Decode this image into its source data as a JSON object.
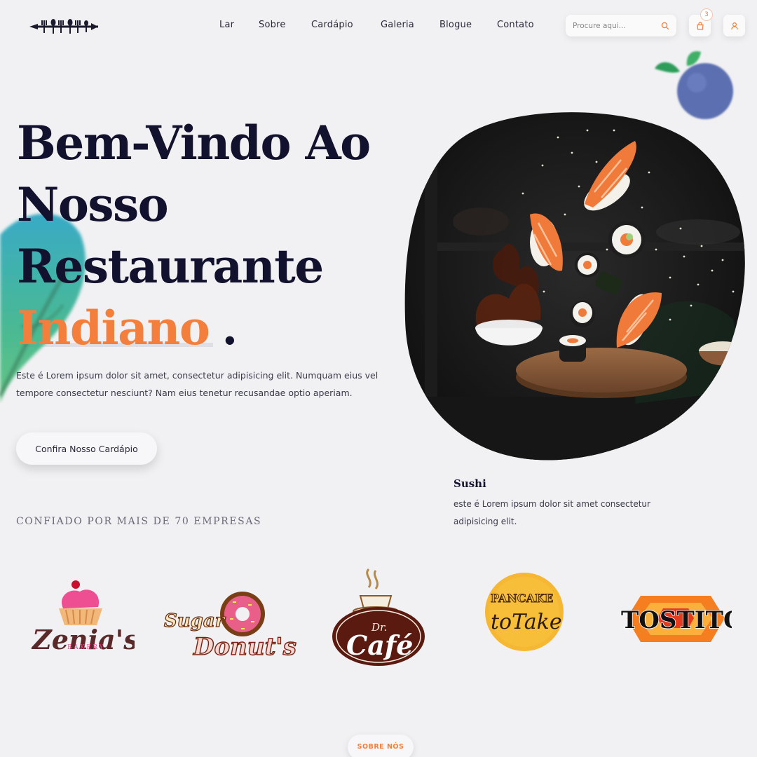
{
  "header": {
    "nav": [
      {
        "label": "Lar"
      },
      {
        "label": "Sobre"
      },
      {
        "label": "Cardápio"
      },
      {
        "label": "Galeria"
      },
      {
        "label": "Blogue"
      },
      {
        "label": "Contato"
      }
    ],
    "search": {
      "placeholder": "Procure aqui..."
    },
    "cart_count": "3"
  },
  "hero": {
    "line1": "Bem-Vindo Ao",
    "line2": "Nosso",
    "line3": "Restaurante",
    "accent": "Indiano",
    "dot": ".",
    "intro": "Este é Lorem ipsum dolor sit amet, consectetur adipisicing elit. Numquam eius vel tempore consectetur nesciunt? Nam eius tenetur recusandae optio aperiam.",
    "cta": "Confira Nosso Cardápio",
    "trusted": "CONFIADO POR MAIS DE 70 EMPRESAS"
  },
  "feature": {
    "title": "Sushi",
    "desc": "este é Lorem ipsum dolor sit amet consectetur adipisicing elit."
  },
  "brands": {
    "zenia": {
      "word": "Zenia's",
      "sub": "BAKERY"
    },
    "sugar": {
      "top": "Sugar",
      "bottom": "Donut's"
    },
    "cafe": {
      "small": "Dr.",
      "big": "Café"
    },
    "pancake": {
      "top": "PANCAKE",
      "bottom": "toTake"
    },
    "tostitos": {
      "word": "TOSTITOS"
    }
  },
  "about_button": "SOBRE NÓS",
  "colors": {
    "accent": "#f47e3c",
    "heading": "#12122e",
    "background": "#f1f1f3"
  }
}
